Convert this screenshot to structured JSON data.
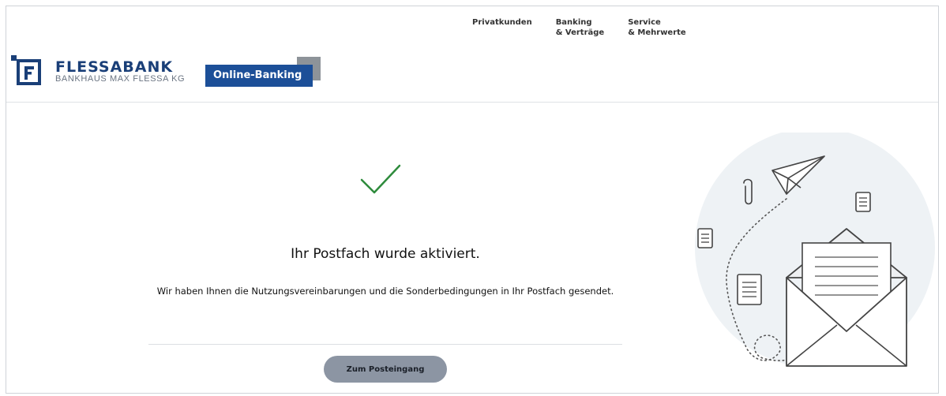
{
  "header": {
    "brand_name": "FLESSABANK",
    "brand_subtitle": "BANKHAUS MAX FLESSA KG",
    "product_badge": "Online-Banking",
    "nav": [
      {
        "line1": "Privatkunden",
        "line2": ""
      },
      {
        "line1": "Banking",
        "line2": "& Verträge"
      },
      {
        "line1": "Service",
        "line2": "& Mehrwerte"
      }
    ]
  },
  "main": {
    "title": "Ihr Postfach wurde aktiviert.",
    "message": "Wir haben Ihnen die Nutzungsvereinbarungen und die Sonderbedingungen in Ihr Postfach gesendet.",
    "button_label": "Zum Posteingang"
  },
  "colors": {
    "brand_blue": "#1a3f78",
    "badge_blue": "#1c4f98",
    "check_green": "#2e8b3c",
    "button_gray": "#8c95a3"
  },
  "icons": [
    "logo-mark-icon",
    "checkmark-icon",
    "paper-plane-icon",
    "paperclip-icon",
    "document-icon",
    "envelope-icon"
  ]
}
